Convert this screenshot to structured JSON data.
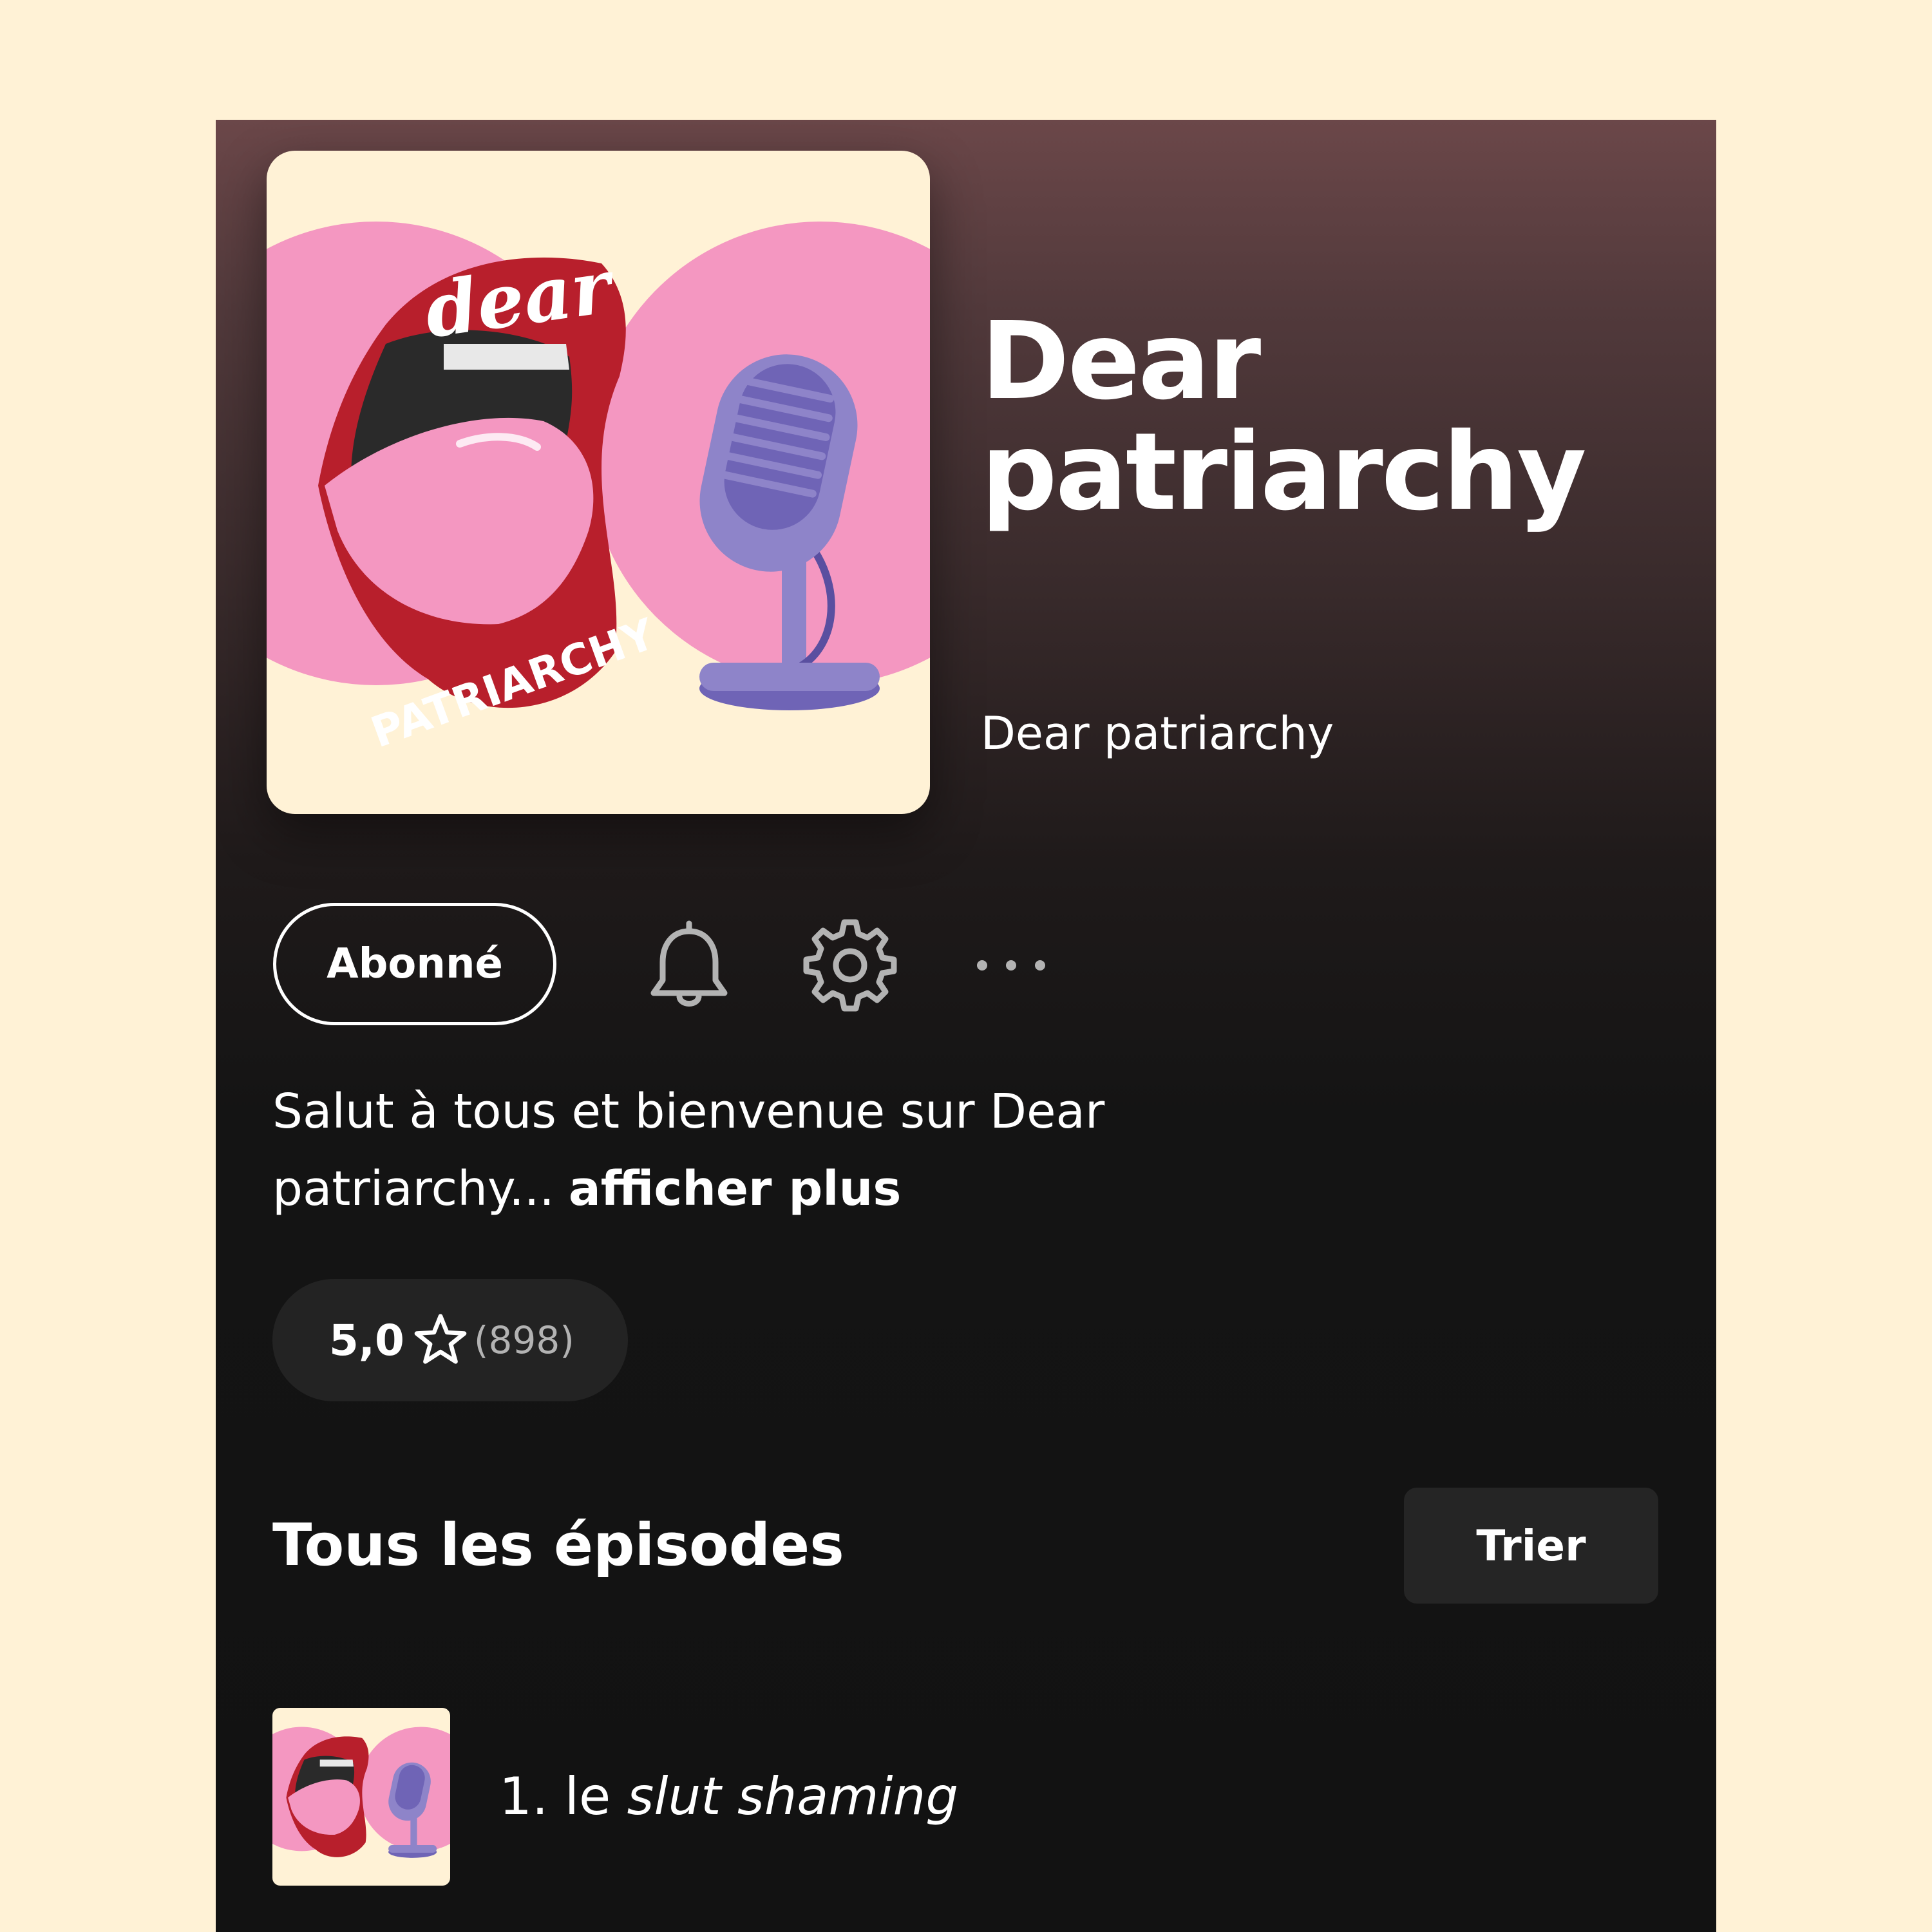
{
  "podcast": {
    "title": "Dear patriarchy",
    "publisher": "Dear patriarchy",
    "cover_art": {
      "top_text": "dear",
      "bottom_text": "PATRIARCHY"
    }
  },
  "actions": {
    "follow_label": "Abonné",
    "icons": [
      "bell-icon",
      "gear-icon",
      "more-dots-icon"
    ]
  },
  "description": {
    "text": "Salut à tous et bienvenue sur Dear patriarchy...",
    "more_label": "afficher plus"
  },
  "rating": {
    "value": "5,0",
    "count": "(898)"
  },
  "episodes_section": {
    "title": "Tous les épisodes",
    "sort_label": "Trier"
  },
  "episodes": [
    {
      "prefix": "1. le",
      "title_italic": "slut shaming"
    }
  ],
  "colors": {
    "page_background": "#fff2d6",
    "app_background": "#121212",
    "header_gradient_top": "#6b4749",
    "cover_pink": "#f497c1",
    "cover_red": "#b81f2c",
    "mic_purple": "#8e84c9",
    "pill_background": "#232323"
  }
}
